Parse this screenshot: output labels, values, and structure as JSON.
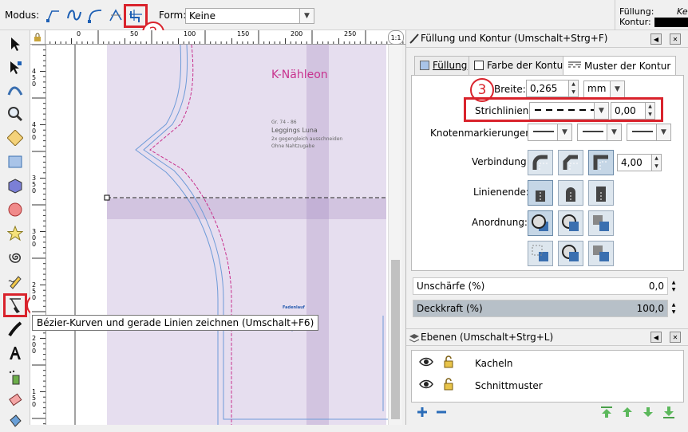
{
  "toolbar": {
    "modus_label": "Modus:",
    "form_label": "Form:",
    "form_value": "Keine",
    "fill_label": "Füllung:",
    "fill_value": "Ke",
    "stroke_label": "Kontur:",
    "badge_2": "2"
  },
  "toolbox": {
    "badge_1": "1",
    "tooltip": "Bézier-Kurven und gerade Linien zeichnen (Umschalt+F6)"
  },
  "rulers": {
    "top": [
      "0",
      "50",
      "100",
      "150",
      "200",
      "250"
    ],
    "left": [
      "4 5 0",
      "4 0 0",
      "3 5 0",
      "3 0 0",
      "2 5 0",
      "2 0 0",
      "1 5 0",
      "1 0 0"
    ]
  },
  "canvas": {
    "brand_title": "K-Nähleon",
    "info_lines": [
      "Gr. 74 - 86",
      "Leggings Luna",
      "2x gegengleich ausschneiden",
      "Ohne Nahtzugabe"
    ],
    "fadenlauf": "Fadenlauf"
  },
  "fill_stroke_panel": {
    "title": "Füllung und Kontur (Umschalt+Strg+F)",
    "tabs": [
      "Füllung",
      "Farbe der Kontur",
      "Muster der Kontur"
    ],
    "badge_3": "3",
    "breite_label": "Breite:",
    "breite_value": "0,265",
    "unit_value": "mm",
    "strichlinien_label": "Strichlinien:",
    "strichlinien_offset": "0,00",
    "knoten_label": "Knotenmarkierungen:",
    "verbindung_label": "Verbindung:",
    "miter_value": "4,00",
    "linienende_label": "Linienende:",
    "anordnung_label": "Anordnung:",
    "blur_label": "Unschärfe (%)",
    "blur_value": "0,0",
    "opacity_label": "Deckkraft (%)",
    "opacity_value": "100,0"
  },
  "layers_panel": {
    "title": "Ebenen (Umschalt+Strg+L)",
    "layers": [
      "Kacheln",
      "Schnittmuster"
    ]
  },
  "colors": {
    "highlight_red": "#d9232c",
    "brand_pink": "#c8328e",
    "guide_purple": "#d8cde6",
    "pattern_blue": "#6f9bd8"
  }
}
